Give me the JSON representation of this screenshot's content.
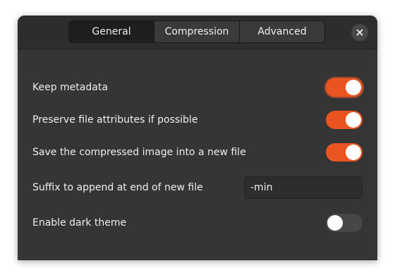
{
  "tabs": [
    {
      "label": "General",
      "active": true
    },
    {
      "label": "Compression",
      "active": false
    },
    {
      "label": "Advanced",
      "active": false
    }
  ],
  "close_icon": "close-icon",
  "settings": {
    "keep_metadata": {
      "label": "Keep metadata",
      "enabled": true
    },
    "preserve_attributes": {
      "label": "Preserve file attributes if possible",
      "enabled": true
    },
    "save_new_file": {
      "label": "Save the compressed image into a new file",
      "enabled": true
    },
    "suffix": {
      "label": "Suffix to append at end of new file",
      "value": "-min"
    },
    "dark_theme": {
      "label": "Enable dark theme",
      "enabled": false
    }
  },
  "colors": {
    "accent": "#e95420",
    "window_bg": "#353535",
    "headerbar_bg": "#2d2d2d"
  }
}
